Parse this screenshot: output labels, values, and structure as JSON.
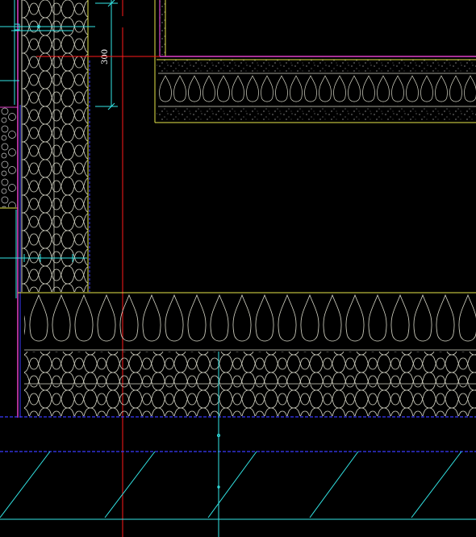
{
  "drawing": {
    "background": "#000000",
    "colors": {
      "insulation": "#d8d8c8",
      "yellow": "#e6e64a",
      "magenta": "#e040c8",
      "red": "#ff1a1a",
      "cyan": "#33e6e6",
      "blue": "#3a3aff",
      "white": "#ffffff",
      "grey": "#b4b4b4"
    },
    "dimension_label": "300"
  }
}
